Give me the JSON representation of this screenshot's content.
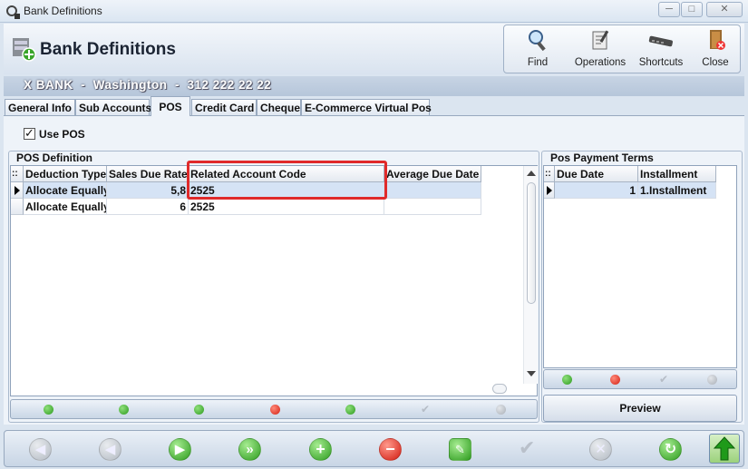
{
  "window": {
    "title": "Bank Definitions",
    "min": "─",
    "max": "□",
    "close": "✕"
  },
  "header": {
    "title": "Bank Definitions"
  },
  "toolbar": {
    "find": "Find",
    "operations": "Operations",
    "shortcuts": "Shortcuts",
    "close": "Close"
  },
  "bank_info": "X BANK  -  Washington  -  312 222 22 22",
  "tabs": [
    "General Info",
    "Sub Accounts",
    "POS",
    "Credit Card",
    "Cheque",
    "E-Commerce Virtual Pos"
  ],
  "active_tab": "POS",
  "use_pos": {
    "label": "Use POS",
    "checked": true,
    "mark": "✓"
  },
  "pos_definition": {
    "title": "POS Definition",
    "corner": "::",
    "columns": [
      "Deduction Type",
      "Sales Due Rate",
      "Related Account Code",
      "Average Due Date"
    ],
    "rows": [
      [
        "Allocate Equally",
        "5,8",
        "2525",
        ""
      ],
      [
        "Allocate Equally",
        "6",
        "2525",
        ""
      ]
    ]
  },
  "pos_payment_terms": {
    "title": "Pos Payment Terms",
    "corner": "::",
    "columns": [
      "Due Date",
      "Installment"
    ],
    "rows": [
      [
        "1",
        "1.Installment"
      ]
    ]
  },
  "preview_label": "Preview",
  "nav_check": "✔",
  "bottom": {
    "prev": "◀",
    "next": "▶",
    "fwd": "»",
    "add": "+",
    "remove": "−",
    "cancel": "✕",
    "refresh": "↻",
    "edit": "✎",
    "save": "⬆"
  }
}
